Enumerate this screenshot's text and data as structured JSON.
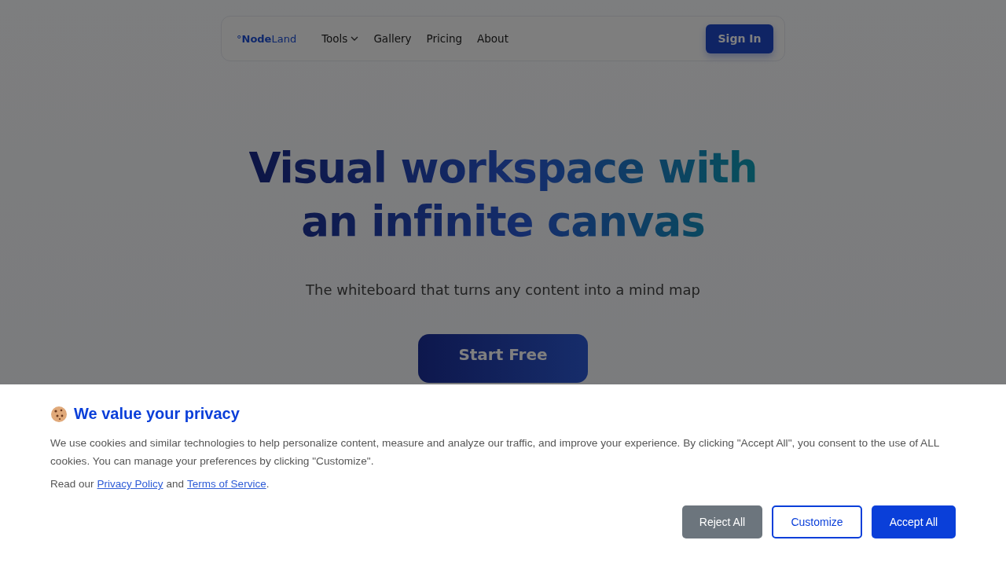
{
  "nav": {
    "logo": "°**Node**Land",
    "items": [
      {
        "label": "Tools",
        "dropdown": true
      },
      {
        "label": "Gallery",
        "dropdown": false
      },
      {
        "label": "Pricing",
        "dropdown": false
      },
      {
        "label": "About",
        "dropdown": false
      }
    ],
    "sign_in": "Sign In"
  },
  "hero": {
    "title_lines": [
      "Visual workspace with",
      "an infinite canvas"
    ],
    "subtitle": "The whiteboard that turns any content into a mind map",
    "cta": "Start Free"
  },
  "cookie_banner": {
    "title": "We value your privacy",
    "body": "We use cookies and similar technologies to help personalize content, measure and analyze our traffic, and improve your experience. By clicking \"Accept All\", you consent to the use of ALL cookies. You can manage your preferences by clicking \"Customize\".",
    "links_prefix": "Read our",
    "privacy_link": "Privacy Policy",
    "links_joiner": "and",
    "terms_link": "Terms of Service",
    "links_suffix": ".",
    "buttons": [
      {
        "label": "Reject All",
        "kind": "secondary"
      },
      {
        "label": "Customize",
        "kind": "outline"
      },
      {
        "label": "Accept All",
        "kind": "primary"
      }
    ]
  }
}
